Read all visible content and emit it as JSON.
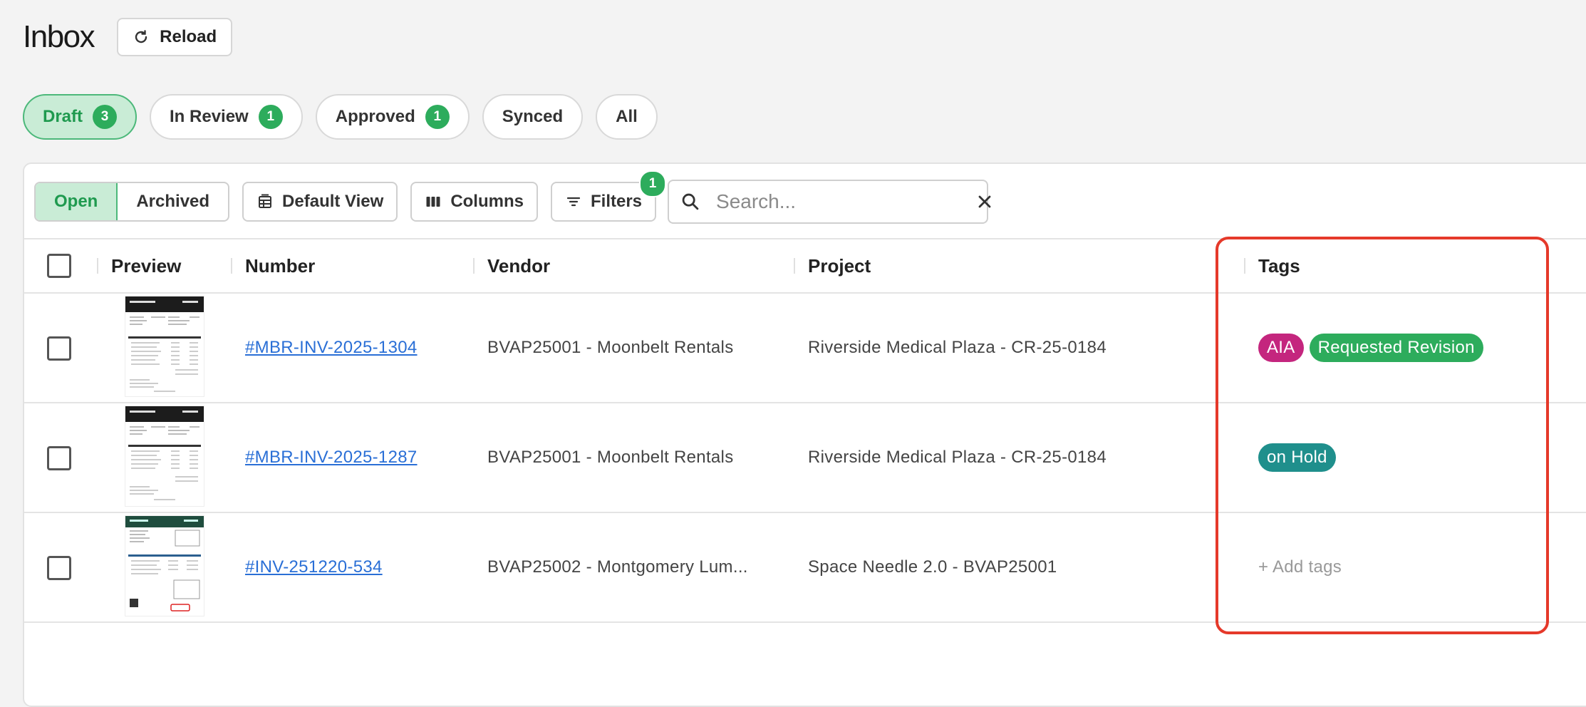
{
  "page": {
    "title": "Inbox",
    "reload_label": "Reload"
  },
  "status_tabs": [
    {
      "label": "Draft",
      "count": "3",
      "active": true
    },
    {
      "label": "In Review",
      "count": "1"
    },
    {
      "label": "Approved",
      "count": "1"
    },
    {
      "label": "Synced",
      "count": ""
    },
    {
      "label": "All",
      "count": ""
    }
  ],
  "toolbar": {
    "open_label": "Open",
    "archived_label": "Archived",
    "default_view_label": "Default View",
    "columns_label": "Columns",
    "filters_label": "Filters",
    "filters_count": "1",
    "search_placeholder": "Search..."
  },
  "table": {
    "headers": {
      "preview": "Preview",
      "number": "Number",
      "vendor": "Vendor",
      "project": "Project",
      "tags": "Tags"
    },
    "rows": [
      {
        "number": "#MBR-INV-2025-1304",
        "vendor": "BVAP25001 - Moonbelt Rentals",
        "project": "Riverside Medical Plaza - CR-25-0184",
        "tags": [
          {
            "label": "AIA",
            "color": "#c4267e"
          },
          {
            "label": "Requested Revision",
            "color": "#2dac5c"
          }
        ]
      },
      {
        "number": "#MBR-INV-2025-1287",
        "vendor": "BVAP25001 - Moonbelt Rentals",
        "project": "Riverside Medical Plaza - CR-25-0184",
        "tags": [
          {
            "label": "on Hold",
            "color": "#1f8f8c"
          }
        ]
      },
      {
        "number": "#INV-251220-534",
        "vendor": "BVAP25002 - Montgomery Lum...",
        "project": "Space Needle 2.0 - BVAP25001",
        "add_tags_label": "+ Add tags"
      }
    ]
  },
  "colors": {
    "accent_green": "#2dac5c",
    "highlight_red": "#e5392a",
    "link_blue": "#2a6fd6"
  }
}
